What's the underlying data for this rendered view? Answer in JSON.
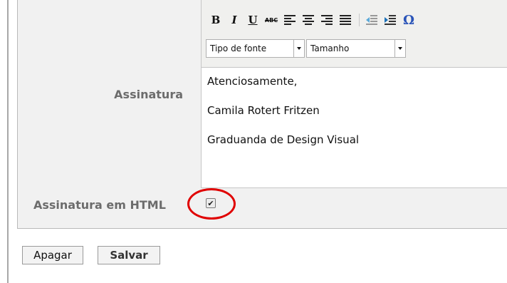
{
  "form": {
    "signature_label": "Assinatura",
    "html_signature_label": "Assinatura em HTML",
    "html_signature_checked": true,
    "checkbox_mark": "✔"
  },
  "editor": {
    "toolbar": {
      "bold": "B",
      "italic": "I",
      "underline": "U",
      "strikethrough": "ABC",
      "special_char": "Ω"
    },
    "font_select": "Tipo de fonte",
    "size_select": "Tamanho",
    "content_lines": [
      "Atenciosamente,",
      "Camila Rotert Fritzen",
      "Graduanda de Design Visual"
    ]
  },
  "actions": {
    "delete_label": "Apagar",
    "save_label": "Salvar"
  },
  "colors": {
    "highlight_circle": "#e00000",
    "omega": "#2a54b8"
  }
}
